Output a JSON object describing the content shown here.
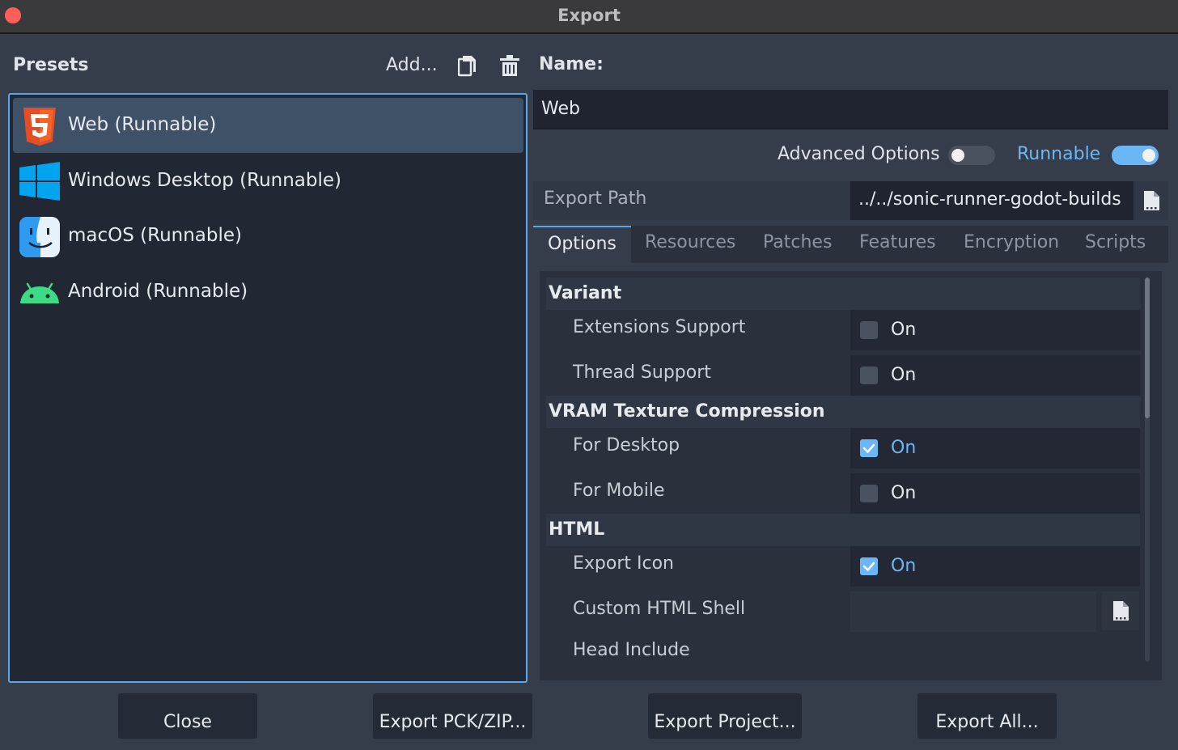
{
  "window": {
    "title": "Export"
  },
  "presets": {
    "label": "Presets",
    "add_label": "Add...",
    "items": [
      {
        "label": "Web (Runnable)",
        "icon": "html5-icon",
        "selected": true
      },
      {
        "label": "Windows Desktop (Runnable)",
        "icon": "windows-icon",
        "selected": false
      },
      {
        "label": "macOS (Runnable)",
        "icon": "macos-finder-icon",
        "selected": false
      },
      {
        "label": "Android (Runnable)",
        "icon": "android-icon",
        "selected": false
      }
    ]
  },
  "preset_settings": {
    "name_label": "Name:",
    "name_value": "Web",
    "advanced_options_label": "Advanced Options",
    "advanced_options_on": false,
    "runnable_label": "Runnable",
    "runnable_on": true,
    "export_path_label": "Export Path",
    "export_path_value": "../../sonic-runner-godot-builds"
  },
  "tabs": [
    {
      "label": "Options",
      "active": true
    },
    {
      "label": "Resources",
      "active": false
    },
    {
      "label": "Patches",
      "active": false
    },
    {
      "label": "Features",
      "active": false
    },
    {
      "label": "Encryption",
      "active": false
    },
    {
      "label": "Scripts",
      "active": false
    }
  ],
  "options": {
    "sections": [
      {
        "title": "Variant"
      },
      {
        "title": "VRAM Texture Compression"
      },
      {
        "title": "HTML"
      }
    ],
    "props": [
      {
        "label": "Extensions Support",
        "value_text": "On",
        "checked": false
      },
      {
        "label": "Thread Support",
        "value_text": "On",
        "checked": false
      },
      {
        "label": "For Desktop",
        "value_text": "On",
        "checked": true
      },
      {
        "label": "For Mobile",
        "value_text": "On",
        "checked": false
      },
      {
        "label": "Export Icon",
        "value_text": "On",
        "checked": true
      },
      {
        "label": "Custom HTML Shell",
        "value_text": ""
      },
      {
        "label": "Head Include",
        "value_text": ""
      }
    ]
  },
  "buttons": {
    "close": "Close",
    "export_pck": "Export PCK/ZIP...",
    "export_project": "Export Project...",
    "export_all": "Export All..."
  },
  "colors": {
    "accent": "#59a7e8",
    "checked": "#6bb6f5",
    "background": "#363d4a",
    "panel": "#212733",
    "selected_item": "#3e5167",
    "close_dot": "#fe5f57",
    "html5": "#e44d26",
    "windows": "#00a4ef",
    "android": "#3ddc84"
  }
}
